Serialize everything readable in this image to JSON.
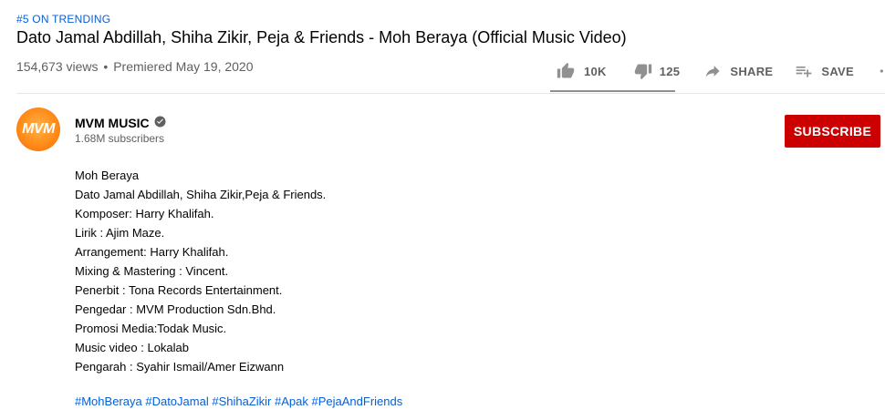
{
  "video": {
    "trending": "#5 ON TRENDING",
    "title": "Dato Jamal Abdillah, Shiha Zikir, Peja & Friends - Moh Beraya (Official Music Video)",
    "views": "154,673 views",
    "separator": "•",
    "premiered": "Premiered May 19, 2020"
  },
  "actions": {
    "likes": "10K",
    "dislikes": "125",
    "share": "SHARE",
    "save": "SAVE",
    "like_ratio": 0.99
  },
  "channel": {
    "avatar_text": "MVM",
    "name": "MVM MUSIC",
    "subscribers": "1.68M subscribers",
    "subscribe_label": "SUBSCRIBE"
  },
  "description": {
    "lines": [
      "Moh Beraya",
      "Dato Jamal Abdillah, Shiha Zikir,Peja & Friends.",
      "Komposer: Harry Khalifah.",
      "Lirik : Ajim Maze.",
      "Arrangement: Harry Khalifah.",
      "Mixing & Mastering : Vincent.",
      "Penerbit : Tona Records Entertainment.",
      "Pengedar : MVM Production Sdn.Bhd.",
      "Promosi Media:Todak Music.",
      "Music video : Lokalab",
      "Pengarah : Syahir Ismail/Amer Eizwann"
    ],
    "hashtags": [
      "#MohBeraya",
      "#DatoJamal",
      "#ShihaZikir",
      "#Apak",
      "#PejaAndFriends"
    ]
  },
  "colors": {
    "link": "#065fd4",
    "subscribe": "#cc0000",
    "secondary_text": "#606060"
  }
}
